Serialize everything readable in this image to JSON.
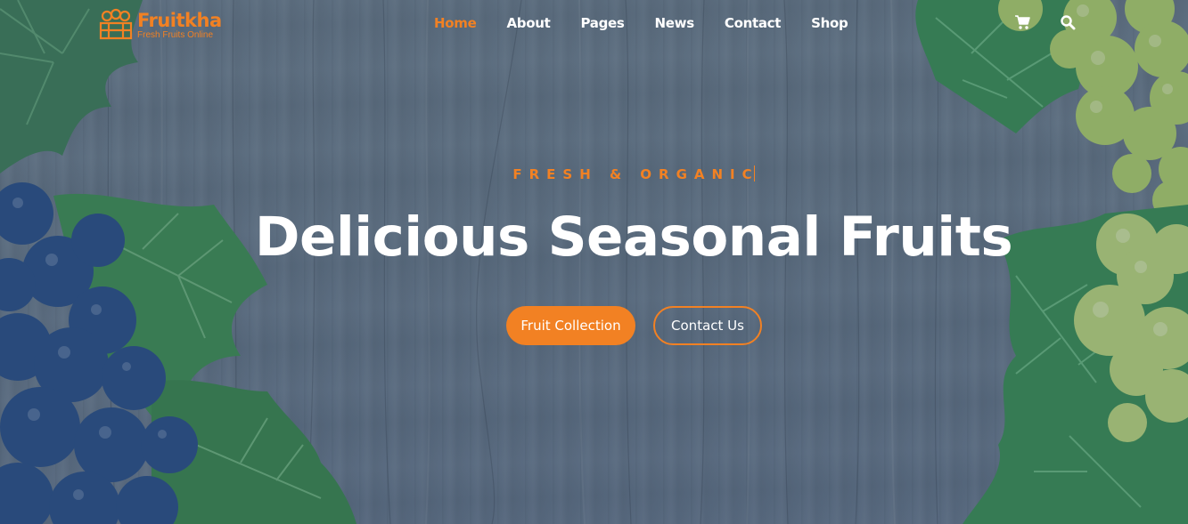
{
  "brand": {
    "name": "Fruitkha",
    "tagline": "Fresh Fruits Online"
  },
  "nav": {
    "items": [
      {
        "label": "Home",
        "active": true
      },
      {
        "label": "About"
      },
      {
        "label": "Pages"
      },
      {
        "label": "News"
      },
      {
        "label": "Contact"
      },
      {
        "label": "Shop"
      }
    ],
    "icons": [
      "shopping-cart-icon",
      "search-icon"
    ]
  },
  "hero": {
    "subtitle": "FRESH & ORGANIC",
    "title": "Delicious Seasonal Fruits",
    "primary_button": "Fruit Collection",
    "secondary_button": "Contact Us"
  },
  "colors": {
    "accent": "#f28123",
    "text": "#ffffff",
    "background": "#687a8b"
  }
}
